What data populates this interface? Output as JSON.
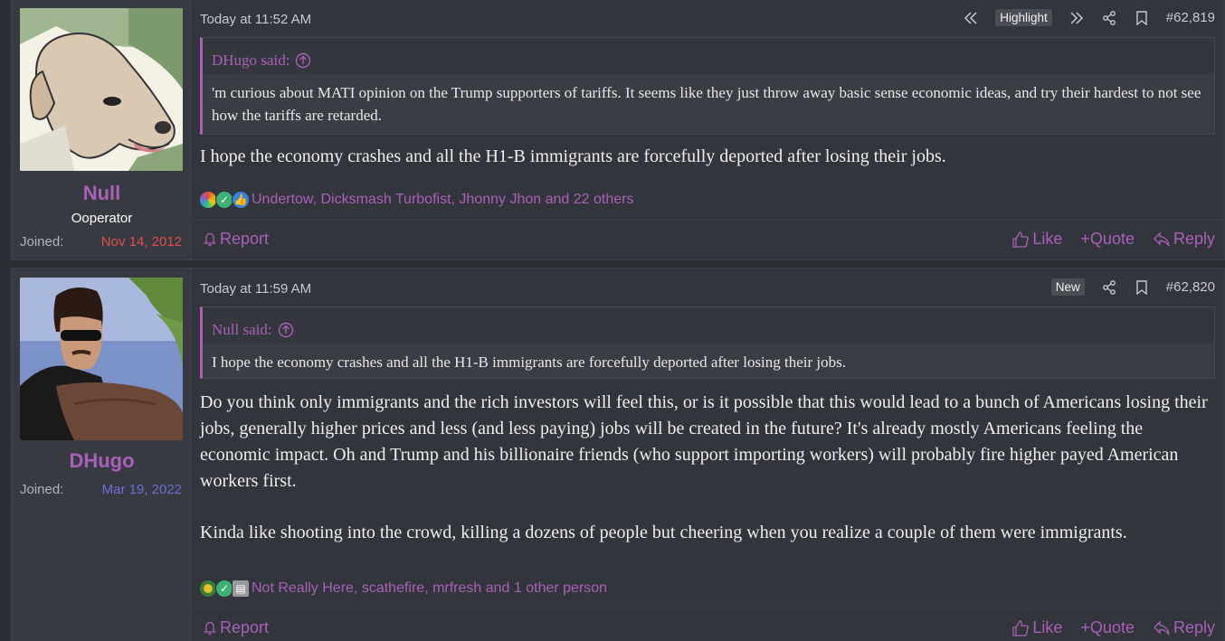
{
  "posts": [
    {
      "username": "Null",
      "user_title": "Ooperator",
      "joined_label": "Joined:",
      "joined_date": "Nov 14, 2012",
      "joined_color": "#e0504a",
      "timestamp": "Today at 11:52 AM",
      "badge": "Highlight",
      "post_number": "#62,819",
      "quote_author": "DHugo said:",
      "quote_text": "'m curious about MATI opinion on the Trump supporters of tariffs. It seems like they just throw away basic sense economic ideas, and try their hardest to not see how the tariffs are retarded.",
      "message": [
        "I hope the economy crashes and all the H1-B immigrants are forcefully deported after losing their jobs."
      ],
      "reactions_text": "Undertow, Dicksmash Turbofist, Jhonny Jhon and 22 others",
      "report": "Report",
      "like": "Like",
      "quote": "+Quote",
      "reply": "Reply"
    },
    {
      "username": "DHugo",
      "joined_label": "Joined:",
      "joined_date": "Mar 19, 2022",
      "joined_color": "#6b6fd6",
      "timestamp": "Today at 11:59 AM",
      "badge": "New",
      "post_number": "#62,820",
      "quote_author": "Null said:",
      "quote_text": "I hope the economy crashes and all the H1-B immigrants are forcefully deported after losing their jobs.",
      "message": [
        "Do you think only immigrants and the rich investors will feel this, or is it possible that this would lead to a bunch of Americans losing their jobs, generally higher prices and less (and less paying) jobs will be created in the future? It's already mostly Americans feeling the economic impact. Oh and Trump and his billionaire friends (who support importing workers) will probably fire higher payed American workers first.",
        "Kinda like shooting into the crowd, killing a dozens of people but cheering when you realize a couple of them were immigrants."
      ],
      "reactions_text": "Not Really Here, scathefire, mrfresh and 1 other person",
      "report": "Report",
      "like": "Like",
      "quote": "+Quote",
      "reply": "Reply"
    }
  ],
  "colors": {
    "accent": "#a960b8",
    "background": "#2b2e33",
    "post_bg": "#32353b"
  },
  "icons": [
    "first-unread-icon",
    "next-icon",
    "share-icon",
    "bookmark-icon",
    "bell-icon",
    "thumbs-up-icon",
    "reply-arrow-icon",
    "arrow-up-circle-icon"
  ]
}
